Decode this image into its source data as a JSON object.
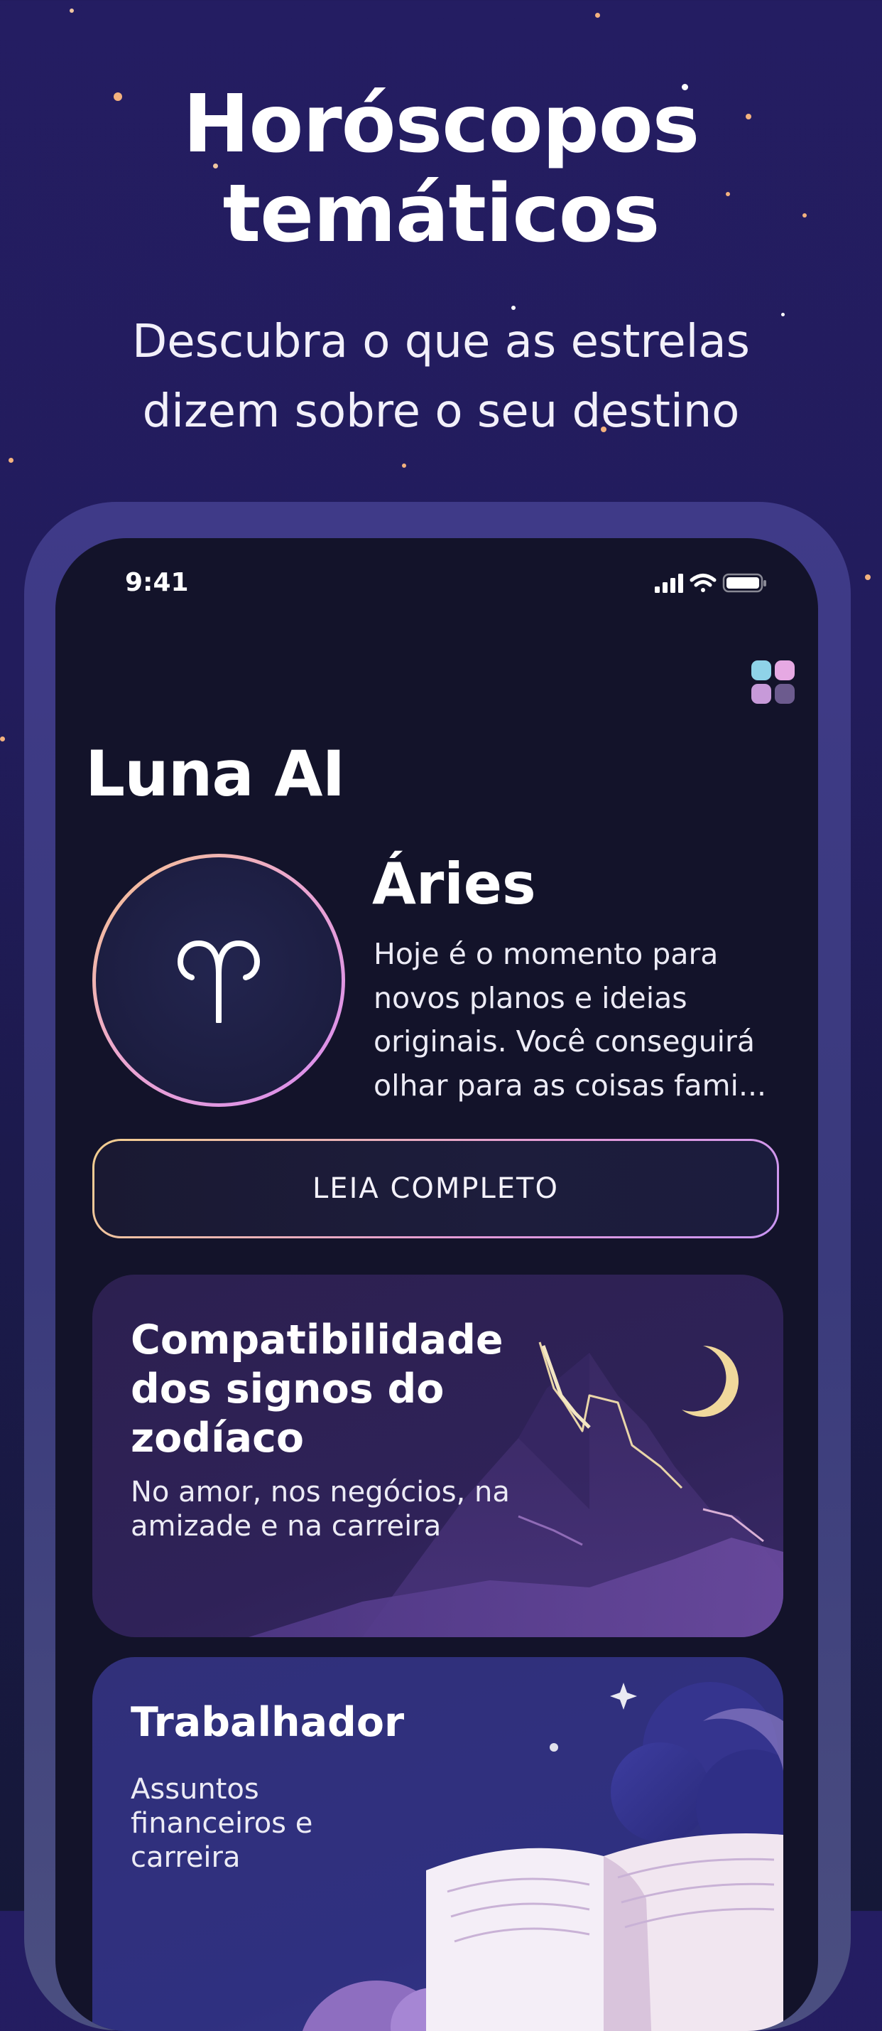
{
  "hero": {
    "title_line1": "Horóscopos",
    "title_line2": "temáticos",
    "subtitle_line1": "Descubra o que as estrelas",
    "subtitle_line2": "dizem sobre o seu destino"
  },
  "status_bar": {
    "time": "9:41",
    "icons": [
      "signal-icon",
      "wifi-icon",
      "battery-icon"
    ]
  },
  "app": {
    "title": "Luna AI",
    "menu_icon": "grid-menu-icon"
  },
  "sign": {
    "name": "Áries",
    "symbol": "♈",
    "description": "Hoje é o momento para novos planos e ideias originais. Você conseguirá olhar para as coisas fami..."
  },
  "read_button": {
    "label": "LEIA COMPLETO"
  },
  "cards": {
    "compat": {
      "title": "Compatibilidade dos signos do zodíaco",
      "subtitle_line1": "No amor, nos negócios, na",
      "subtitle_line2": "amizade e na carreira"
    },
    "work": {
      "title": "Trabalhador",
      "subtitle_line1": "Assuntos",
      "subtitle_line2": "financeiros e",
      "subtitle_line3": "carreira"
    }
  },
  "colors": {
    "background_top": "#241d62",
    "background_bottom": "#151838",
    "screen": "#13132a",
    "accent_gold": "#f3cf8e",
    "accent_pink": "#e49ad8",
    "star": "#f3b27e"
  }
}
